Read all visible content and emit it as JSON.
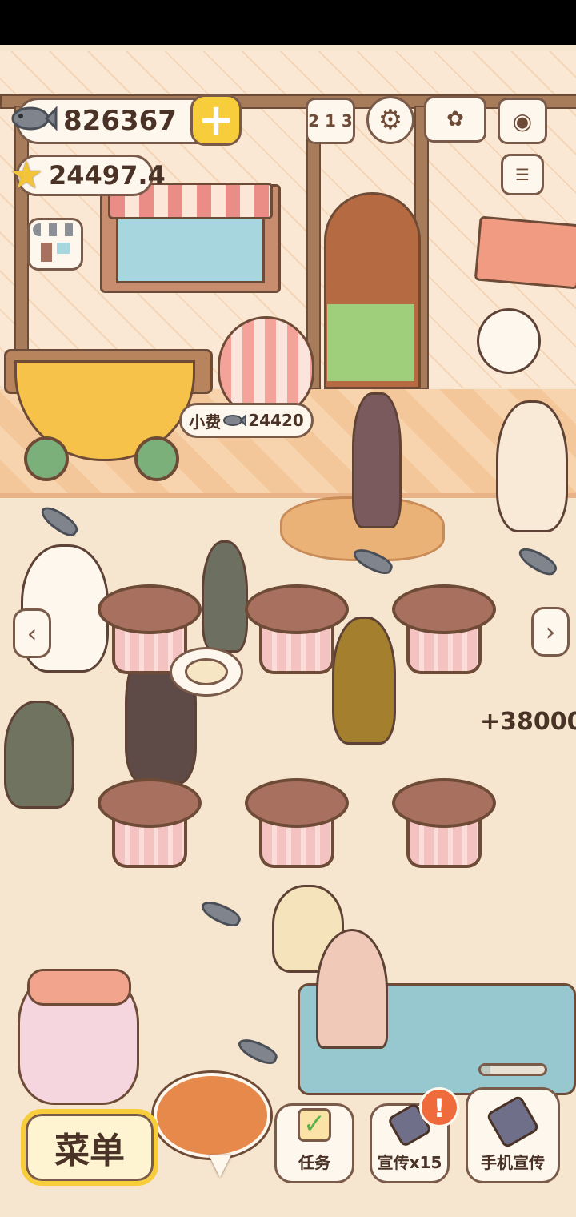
{
  "hud": {
    "fish_currency": "826367",
    "star_currency": "24497.4",
    "add_label": "+"
  },
  "top_icons": {
    "ranking_label": "2 1 3",
    "settings_icon": "gear-icon",
    "recipe_book_icon": "book-icon",
    "camera_icon": "camera-icon"
  },
  "tip": {
    "label": "小费",
    "amount": "24420"
  },
  "earn_popup": "+38000",
  "nav": {
    "left_arrow": "‹",
    "right_arrow": "›"
  },
  "bottom": {
    "menu_label": "菜单",
    "collapse_arrow": "▼",
    "tasks_label": "任务",
    "promote_label": "宣传x15",
    "phone_promote_label": "手机宣传",
    "alert_mark": "!"
  },
  "colors": {
    "accent_yellow": "#f7cd3b",
    "alert_orange": "#ef6b3c",
    "outline_brown": "#7a5a48",
    "panel_cream": "#fdf7ee"
  }
}
